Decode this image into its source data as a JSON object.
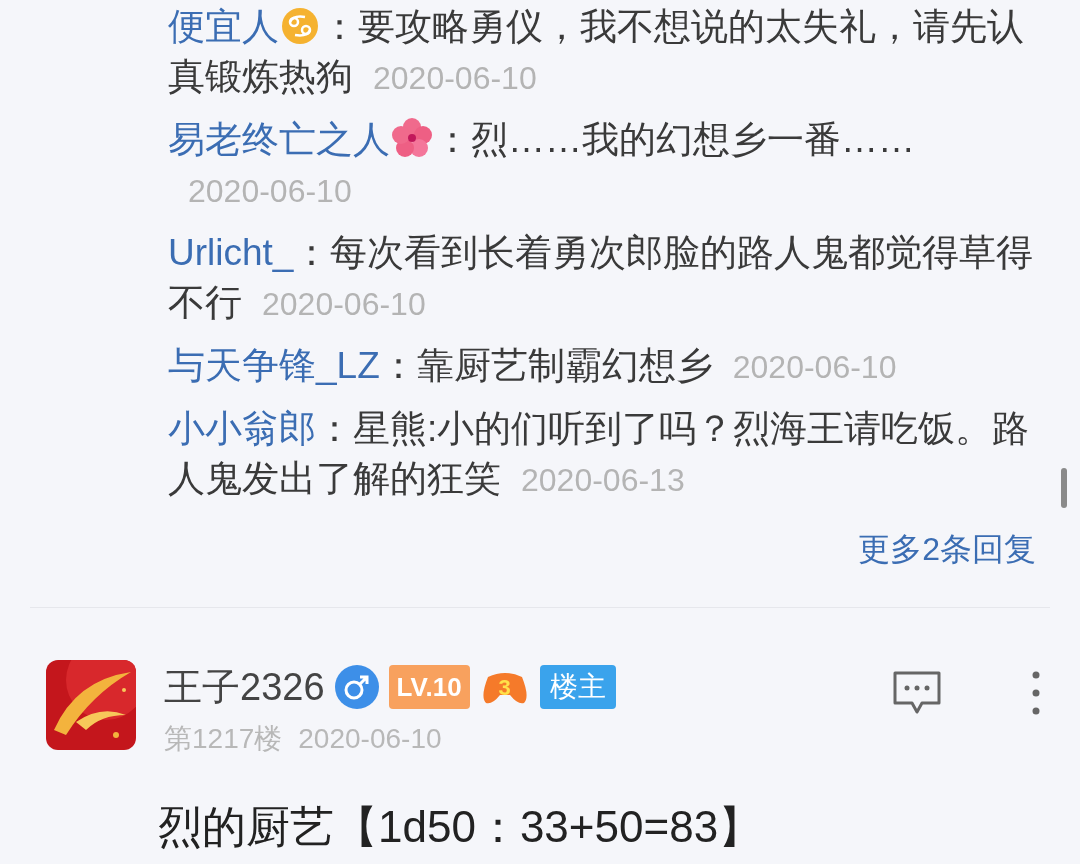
{
  "replies": [
    {
      "kind": "zodiac",
      "author": "便宜人",
      "text": "：要攻略勇仪，我不想说的太失礼，请先认真锻炼热狗",
      "date": "2020-06-10"
    },
    {
      "kind": "flower",
      "author": "易老终亡之人",
      "text": "：烈……我的幻想乡一番……",
      "date": "2020-06-10"
    },
    {
      "kind": "plain",
      "author": "Urlicht_",
      "text": "：每次看到长着勇次郎脸的路人鬼都觉得草得不行",
      "date": "2020-06-10"
    },
    {
      "kind": "plain",
      "author": "与天争锋_LZ",
      "text": "：靠厨艺制霸幻想乡",
      "date": "2020-06-10"
    },
    {
      "kind": "plain",
      "author": "小小翁郎",
      "text": "：星熊:小的们听到了吗？烈海王请吃饭。路人鬼发出了解的狂笑",
      "date": "2020-06-13"
    }
  ],
  "more_replies": "更多2条回复",
  "post": {
    "username": "王子2326",
    "level": "LV.10",
    "game_badge": "3",
    "owner_badge": "楼主",
    "floor": "第1217楼",
    "date": "2020-06-10",
    "content": "烈的厨艺【1d50：33+50=83】"
  }
}
